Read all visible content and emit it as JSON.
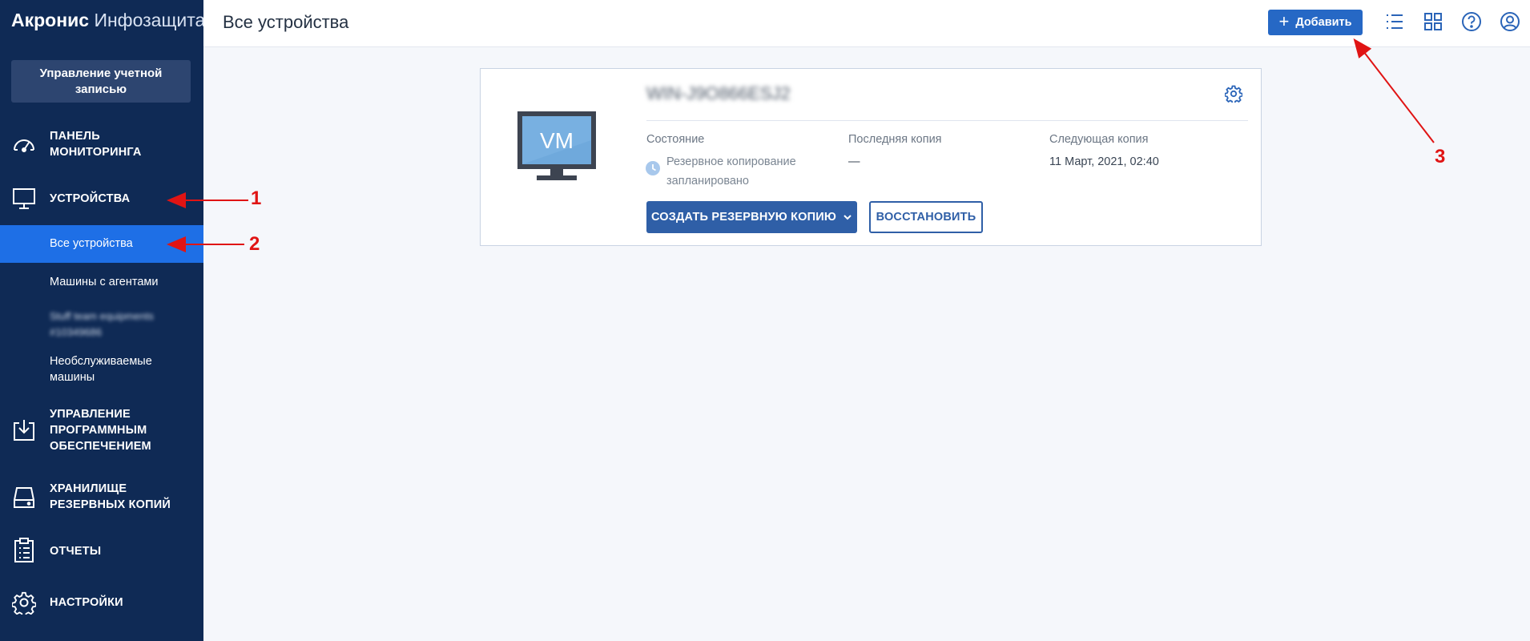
{
  "sidebar": {
    "brand_bold": "Акронис",
    "brand_light": "Инфозащита",
    "account_button": "Управление учетной\nзаписью",
    "nav": {
      "dashboard": "ПАНЕЛЬ\nМОНИТОРИНГА",
      "devices": "УСТРОЙСТВА",
      "software": "УПРАВЛЕНИЕ\nПРОГРАММНЫМ\nОБЕСПЕЧЕНИЕМ",
      "storage": "ХРАНИЛИЩЕ\nРЕЗЕРВНЫХ КОПИЙ",
      "reports": "ОТЧЕТЫ",
      "settings": "НАСТРОЙКИ"
    },
    "sub_items": [
      "Все устройства",
      "Машины с агентами",
      "Stuff team equipments\n#10349686",
      "Необслуживаемые\nмашины"
    ]
  },
  "header": {
    "title": "Все устройства",
    "add_button": "Добавить"
  },
  "device": {
    "icon_text": "VM",
    "name": "WIN-J9O866ESJ2",
    "status_label": "Состояние",
    "status_value": "Резервное копирование\nзапланировано",
    "last_label": "Последняя копия",
    "last_value": "—",
    "next_label": "Следующая копия",
    "next_value": "11 Март, 2021, 02:40",
    "backup_button": "СОЗДАТЬ РЕЗЕРВНУЮ КОПИЮ",
    "restore_button": "ВОССТАНОВИТЬ"
  },
  "annotations": [
    "1",
    "2",
    "3"
  ],
  "colors": {
    "sidebar_bg": "#0f2a55",
    "active_item": "#1e6fe6",
    "primary_button": "#2668c5",
    "annotation": "#e01414"
  },
  "icons": [
    "dashboard-icon",
    "monitor-icon",
    "software-download-icon",
    "storage-icon",
    "reports-icon",
    "settings-icon",
    "list-view-icon",
    "grid-view-icon",
    "help-icon",
    "user-icon",
    "gear-icon",
    "clock-icon",
    "chevron-down-icon"
  ]
}
